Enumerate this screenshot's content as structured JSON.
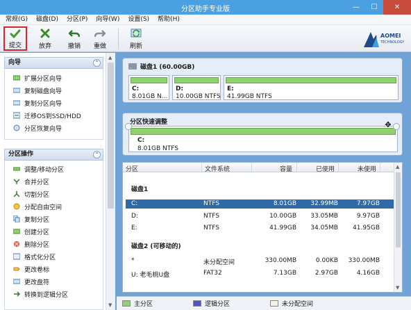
{
  "window": {
    "title": "分区助手专业版",
    "min": "—",
    "max": "☐",
    "close": "✕"
  },
  "menu": [
    "常规(G)",
    "磁盘(D)",
    "分区(P)",
    "向导(W)",
    "设置(S)",
    "帮助(H)"
  ],
  "toolbar": {
    "submit": "提交",
    "discard": "放弃",
    "undo": "撤销",
    "redo": "重做",
    "refresh": "刷新",
    "brand_name": "AOMEI",
    "brand_sub": "TECHNOLOGY"
  },
  "sidebar": {
    "wizard_title": "向导",
    "wizard_items": [
      "扩展分区向导",
      "复制磁盘向导",
      "复制分区向导",
      "迁移OS到SSD/HDD",
      "分区恢复向导"
    ],
    "ops_title": "分区操作",
    "ops_items": [
      "调整/移动分区",
      "合并分区",
      "切割分区",
      "分配自由空间",
      "复制分区",
      "创建分区",
      "删除分区",
      "格式化分区",
      "更改卷标",
      "更改盘符",
      "转换到逻辑分区"
    ]
  },
  "disk1": {
    "title": "磁盘1 (60.00GB)",
    "partitions": [
      {
        "name": "C:",
        "info": "8.01GB N..."
      },
      {
        "name": "D:",
        "info": "10.00GB NTFS"
      },
      {
        "name": "E:",
        "info": "41.99GB NTFS"
      }
    ]
  },
  "resize": {
    "title": "分区快速调整",
    "name": "C:",
    "info": "8.01GB NTFS"
  },
  "table": {
    "headers": {
      "name": "分区",
      "fs": "文件系统",
      "cap": "容量",
      "used": "已使用",
      "free": "未使用"
    },
    "groups": [
      {
        "title": "磁盘1",
        "rows": [
          {
            "name": "C:",
            "fs": "NTFS",
            "cap": "8.01GB",
            "used": "32.99MB",
            "free": "7.97GB",
            "selected": true
          },
          {
            "name": "D:",
            "fs": "NTFS",
            "cap": "10.00GB",
            "used": "33.05MB",
            "free": "9.97GB"
          },
          {
            "name": "E:",
            "fs": "NTFS",
            "cap": "41.99GB",
            "used": "34.05MB",
            "free": "41.95GB"
          }
        ]
      },
      {
        "title": "磁盘2 (可移动的)",
        "rows": [
          {
            "name": "*",
            "fs": "未分配空间",
            "cap": "330.00MB",
            "used": "0.00KB",
            "free": "330.00MB"
          },
          {
            "name": "U: 老毛桃U盘",
            "fs": "FAT32",
            "cap": "7.13GB",
            "used": "2.97GB",
            "free": "4.16GB"
          }
        ]
      }
    ]
  },
  "legend": {
    "primary": "主分区",
    "logical": "逻辑分区",
    "unallocated": "未分配空间",
    "primary_color": "#8fd16d",
    "logical_color": "#4d55c8",
    "unallocated_color": "#f4f1e6"
  },
  "colors": {
    "accent": "#2e6aa8",
    "partition_bar": "#8fd16d",
    "selected_border": "#d9232d"
  }
}
